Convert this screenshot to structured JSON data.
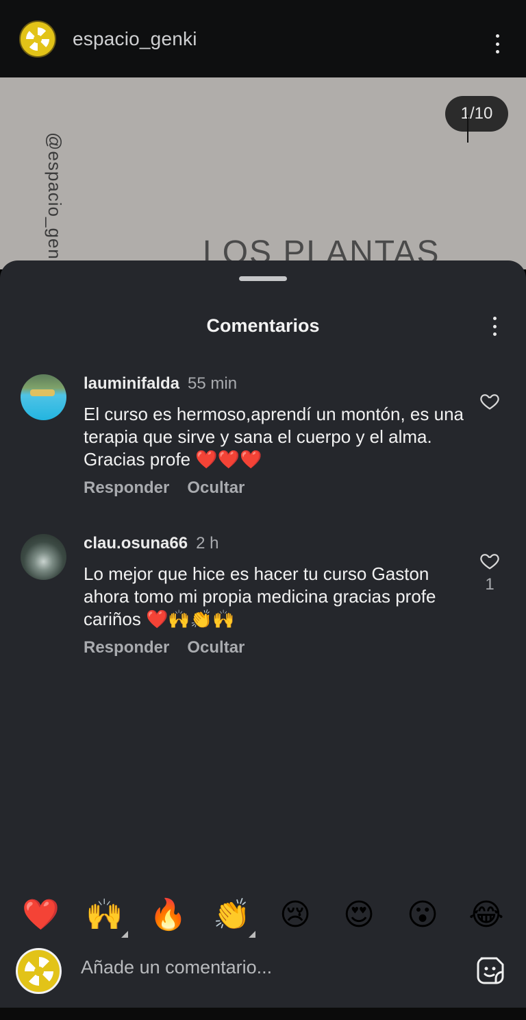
{
  "header": {
    "username": "espacio_genki",
    "avatar_icon": "genki-logo-icon",
    "menu_icon": "more-vertical-icon"
  },
  "post": {
    "page_counter": "1/10",
    "vertical_handle": "@espacio_genki",
    "title": "LOS PLANTAS"
  },
  "sheet": {
    "title": "Comentarios",
    "menu_icon": "more-vertical-icon"
  },
  "comments": [
    {
      "username": "lauminifalda",
      "time": "55 min",
      "text": "El curso es hermoso,aprendí un montón, es una terapia que sirve y sana el cuerpo y el alma. Gracias profe ❤️❤️❤️",
      "reply_label": "Responder",
      "hide_label": "Ocultar",
      "likes": ""
    },
    {
      "username": "clau.osuna66",
      "time": "2 h",
      "text": "Lo mejor que hice es hacer tu curso Gaston ahora tomo mi propia medicina gracias profe cariños ❤️🙌👏🙌",
      "reply_label": "Responder",
      "hide_label": "Ocultar",
      "likes": "1"
    }
  ],
  "quick_reactions": [
    "❤️",
    "🙌",
    "🔥",
    "👏",
    "😢",
    "😍",
    "😮",
    "😂"
  ],
  "composer": {
    "placeholder": "Añade un comentario...",
    "sticker_icon": "sticker-icon"
  },
  "colors": {
    "sheet_bg": "#25272c",
    "top_bar_bg": "#0e0f10",
    "accent_yellow": "#e2c318"
  }
}
